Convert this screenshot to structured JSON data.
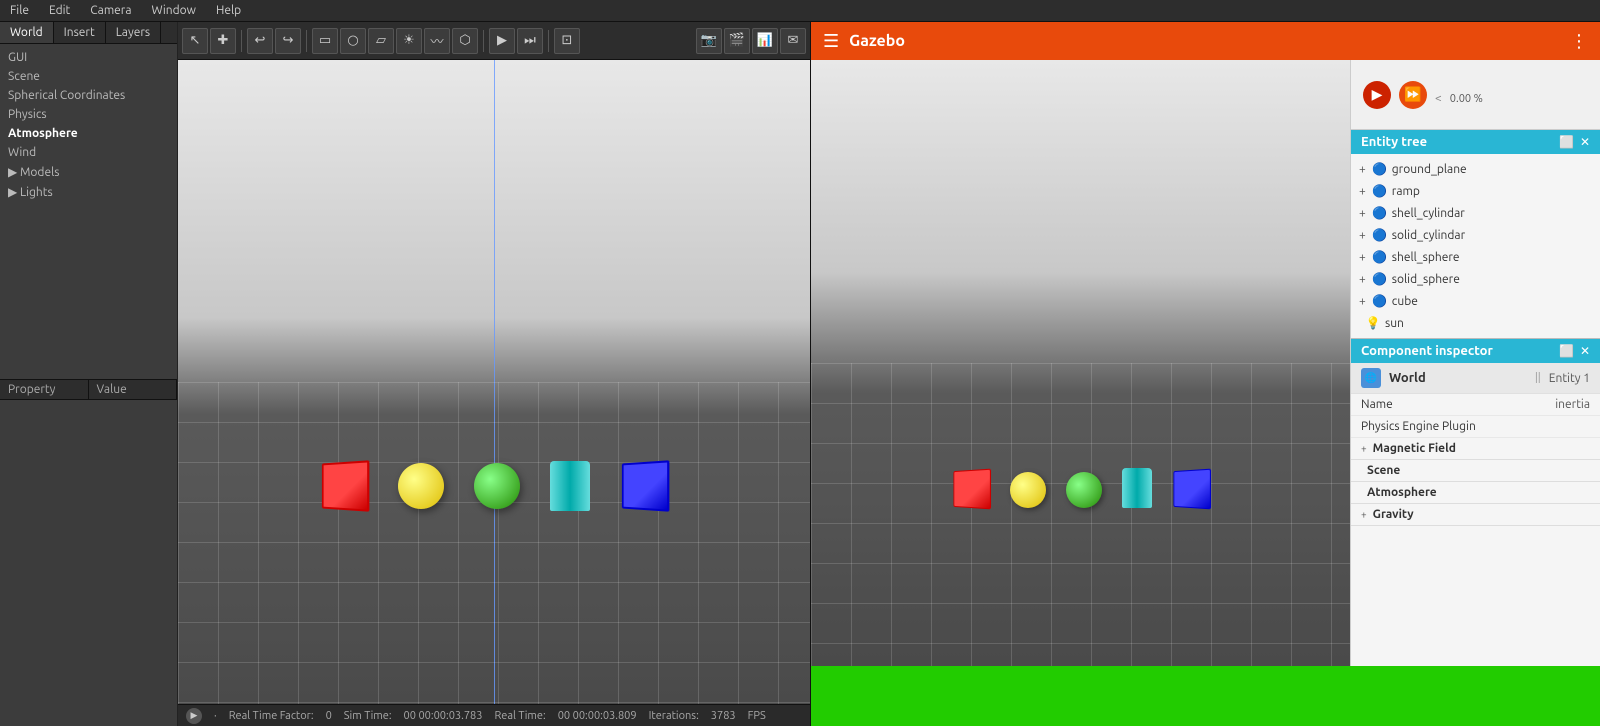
{
  "menubar": {
    "items": [
      "File",
      "Edit",
      "Camera",
      "Window",
      "Help"
    ]
  },
  "left_panel": {
    "tabs": [
      "World",
      "Insert",
      "Layers"
    ],
    "active_tab": "World",
    "tree_items": [
      {
        "label": "GUI",
        "indent": false
      },
      {
        "label": "Scene",
        "indent": false
      },
      {
        "label": "Spherical Coordinates",
        "indent": false
      },
      {
        "label": "Physics",
        "indent": false
      },
      {
        "label": "Atmosphere",
        "indent": false
      },
      {
        "label": "Wind",
        "indent": false
      },
      {
        "label": "Models",
        "indent": false,
        "expandable": true
      },
      {
        "label": "Lights",
        "indent": false,
        "expandable": true
      }
    ],
    "properties": {
      "col1": "Property",
      "col2": "Value"
    }
  },
  "toolbar": {
    "tools": [
      "↖",
      "+",
      "↺",
      "▭",
      "○",
      "▱",
      "☀",
      "~",
      "▣",
      "▸",
      "▸|",
      "⬜"
    ],
    "right_tools": [
      "📷",
      "🎬",
      "📊",
      "✉"
    ]
  },
  "gazebo": {
    "title": "Gazebo",
    "menu_icon": "☰",
    "dots_icon": "⋮"
  },
  "play_controls": {
    "play_icon": "▶",
    "ff_icon": "⏩",
    "progress_label": "0.00 %",
    "chevron": "<"
  },
  "entity_tree": {
    "title": "Entity tree",
    "items": [
      {
        "label": "ground_plane",
        "icon": "🔵",
        "expandable": true
      },
      {
        "label": "ramp",
        "icon": "🔵",
        "expandable": true
      },
      {
        "label": "shell_cylindar",
        "icon": "🔵",
        "expandable": true
      },
      {
        "label": "solid_cylindar",
        "icon": "🔵",
        "expandable": true
      },
      {
        "label": "shell_sphere",
        "icon": "🔵",
        "expandable": true
      },
      {
        "label": "solid_sphere",
        "icon": "🔵",
        "expandable": true
      },
      {
        "label": "cube",
        "icon": "🔵",
        "expandable": true
      },
      {
        "label": "sun",
        "icon": "💡",
        "expandable": false
      }
    ]
  },
  "component_inspector": {
    "title": "Component inspector",
    "world_label": "World",
    "entity_label": "Entity 1",
    "toggle": "||",
    "props": [
      {
        "label": "Name",
        "value": "inertia"
      },
      {
        "label": "Physics Engine Plugin",
        "value": ""
      }
    ],
    "sections": [
      {
        "label": "Magnetic Field",
        "expandable": true
      },
      {
        "label": "Scene",
        "expandable": false
      },
      {
        "label": "Atmosphere",
        "expandable": false
      },
      {
        "label": "Gravity",
        "expandable": true
      }
    ]
  },
  "status_bar": {
    "realtime_factor_label": "Real Time Factor:",
    "realtime_factor_value": "0",
    "sim_time_label": "Sim Time:",
    "sim_time_value": "00 00:00:03.783",
    "real_time_label": "Real Time:",
    "real_time_value": "00 00:00:03.809",
    "iterations_label": "Iterations:",
    "iterations_value": "3783",
    "fps_label": "FPS"
  }
}
